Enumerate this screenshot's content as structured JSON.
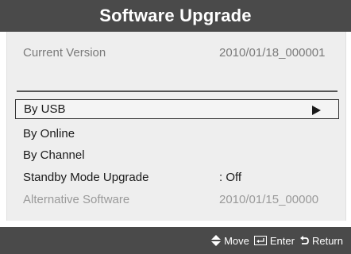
{
  "title": "Software Upgrade",
  "current_version": {
    "label": "Current Version",
    "value": "2010/01/18_000001"
  },
  "menu": {
    "items": [
      {
        "label": "By USB",
        "value": ""
      },
      {
        "label": "By Online",
        "value": ""
      },
      {
        "label": "By Channel",
        "value": ""
      },
      {
        "label": "Standby Mode Upgrade",
        "value": ": Off"
      },
      {
        "label": "Alternative Software",
        "value": "2010/01/15_00000"
      }
    ],
    "selected_index": 0
  },
  "footer": {
    "move_label": "Move",
    "enter_label": "Enter",
    "return_label": "Return",
    "icons": [
      "move-icon",
      "enter-icon",
      "return-icon"
    ]
  },
  "colors": {
    "title_bar": "#4a4a4a",
    "panel": "#eeeeee",
    "text": "#1a1a1a",
    "muted": "#9a9a9a"
  }
}
